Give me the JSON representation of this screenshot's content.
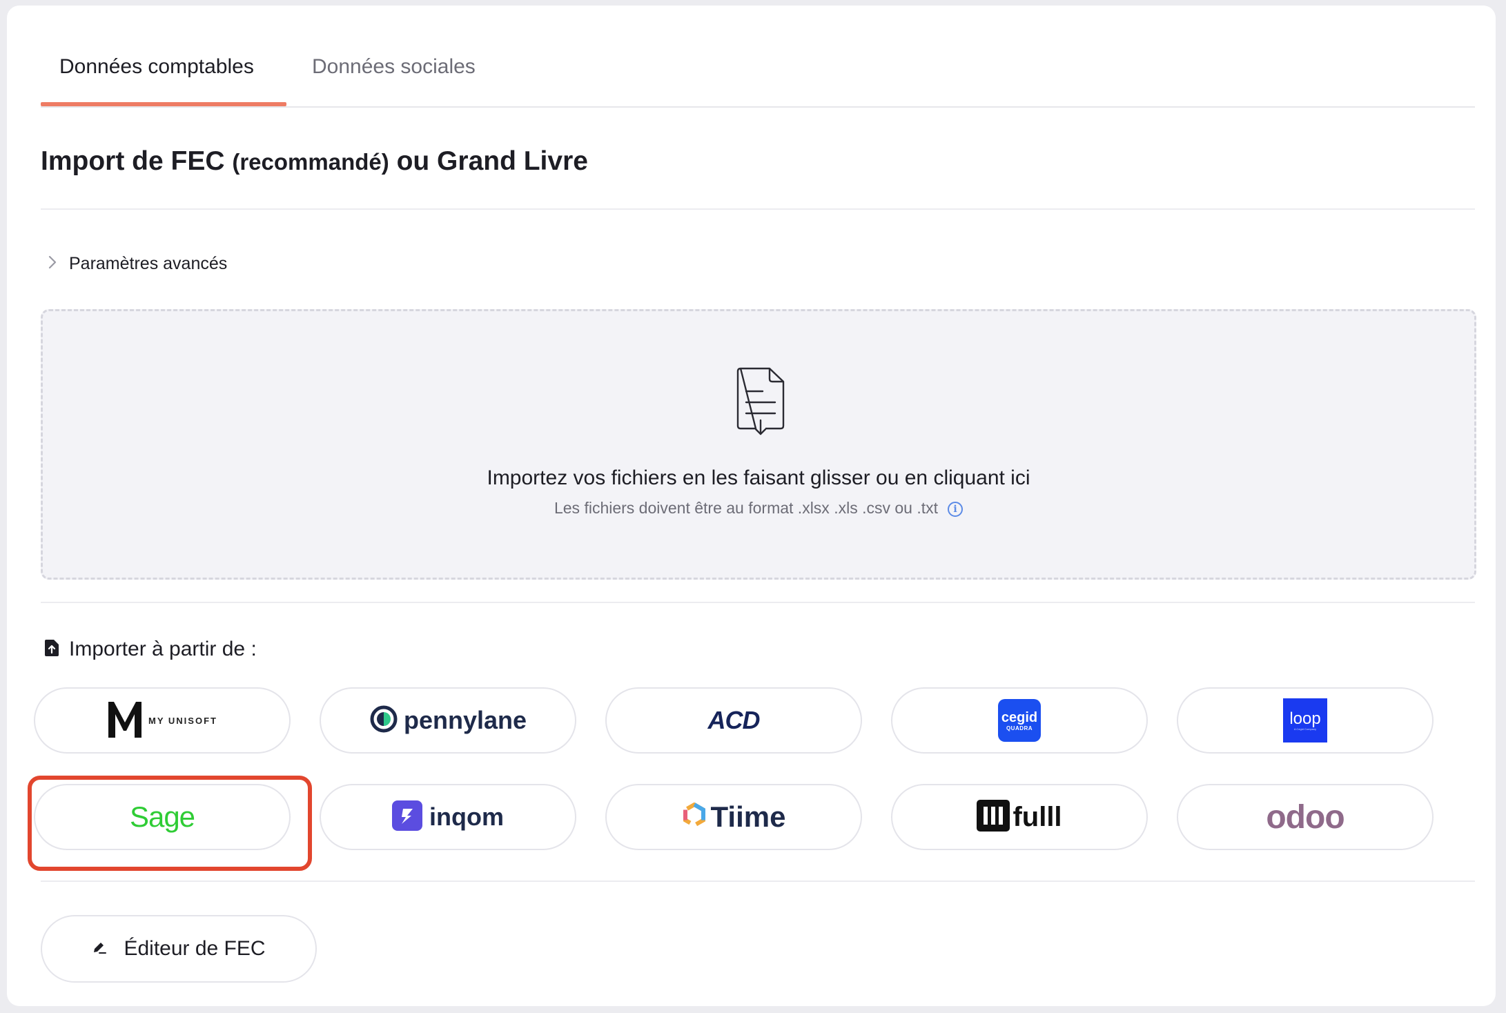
{
  "tabs": [
    {
      "label": "Données comptables",
      "active": true
    },
    {
      "label": "Données sociales",
      "active": false
    }
  ],
  "section": {
    "title_main": "Import de FEC ",
    "title_small": "(recommandé)",
    "title_end": " ou Grand Livre"
  },
  "advanced": {
    "label": "Paramètres avancés"
  },
  "dropzone": {
    "main_text": "Importez vos fichiers en les faisant glisser ou en cliquant ici",
    "sub_text": "Les fichiers doivent être au format .xlsx .xls .csv ou .txt"
  },
  "import_from": {
    "label": "Importer à partir de :"
  },
  "providers": [
    {
      "name": "MY UNISOFT",
      "logo_letter": "M"
    },
    {
      "name": "pennylane"
    },
    {
      "name": "ACD"
    },
    {
      "name": "cegid",
      "sub": "QUADRA"
    },
    {
      "name": "loop",
      "sub": "A Cegid Company"
    },
    {
      "name": "Sage",
      "highlighted": true
    },
    {
      "name": "inqom"
    },
    {
      "name": "Tiime"
    },
    {
      "name": "fulll"
    },
    {
      "name": "odoo"
    }
  ],
  "editor": {
    "label": "Éditeur de FEC"
  },
  "colors": {
    "accent": "#ee7c64",
    "highlight": "#e2462e",
    "sage_green": "#2fcc35",
    "cegid_blue": "#1b4ff0",
    "loop_blue": "#1a3af0",
    "inqom_purple": "#5b4de0",
    "pennylane_navy": "#1e2a4a",
    "odoo_purple": "#8f6a8a"
  }
}
